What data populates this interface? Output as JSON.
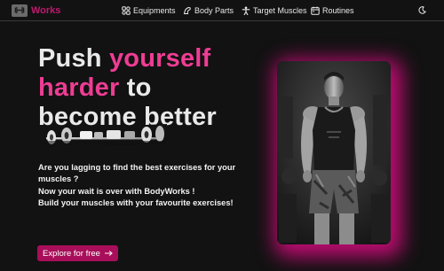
{
  "brand": {
    "name": "Works",
    "accent_color": "#c0186e",
    "highlight_color": "#ee3d93",
    "icon": "dumbbell-icon"
  },
  "nav": {
    "links": [
      {
        "label": "Equipments",
        "icon": "equipment-icon"
      },
      {
        "label": "Body Parts",
        "icon": "body-icon"
      },
      {
        "label": "Target Muscles",
        "icon": "person-icon"
      },
      {
        "label": "Routines",
        "icon": "calendar-icon"
      }
    ],
    "theme_toggle_icon": "moon-icon"
  },
  "hero": {
    "headline": {
      "part1": "Push ",
      "part2": "yourself",
      "part3": "harder",
      "part4": " to",
      "part5": "become better"
    },
    "paragraph_lines": [
      "Are you lagging to find the best exercises for your",
      "muscles ?",
      "Now your wait is over with BodyWorks !",
      "Build your muscles with your favourite exercises!"
    ],
    "cta_label": "Explore for free",
    "cta_icon": "arrow-right-icon",
    "cta_color": "#a80e59",
    "image": "bodybuilder-photo",
    "decorative_graphic": "dumbbell-rack-graphic"
  }
}
